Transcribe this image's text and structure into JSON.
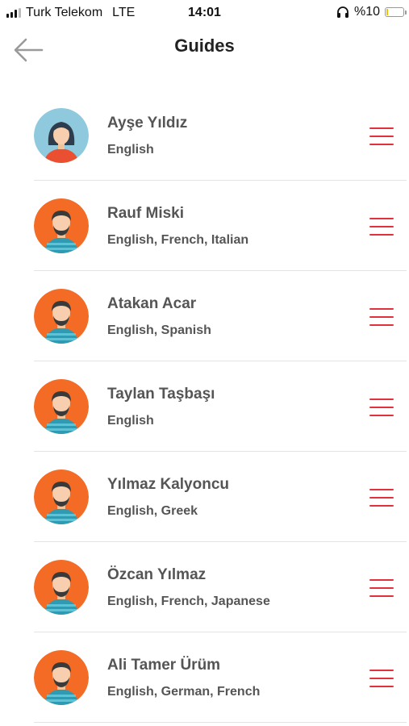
{
  "status_bar": {
    "carrier": "Turk Telekom",
    "network": "LTE",
    "time": "14:01",
    "battery": "%10",
    "battery_level": 0.1
  },
  "header": {
    "title": "Guides"
  },
  "colors": {
    "accent": "#e0323d",
    "male_avatar_bg": "#f36b24",
    "female_avatar_bg": "#8ec9dd"
  },
  "guides": [
    {
      "name": "Ayşe Yıldız",
      "languages": "English",
      "avatar": "female-avatar"
    },
    {
      "name": "Rauf Miski",
      "languages": "English, French, Italian",
      "avatar": "male-avatar"
    },
    {
      "name": "Atakan Acar",
      "languages": "English, Spanish",
      "avatar": "male-avatar"
    },
    {
      "name": "Taylan Taşbaşı",
      "languages": "English",
      "avatar": "male-avatar"
    },
    {
      "name": "Yılmaz Kalyoncu",
      "languages": "English, Greek",
      "avatar": "male-avatar"
    },
    {
      "name": "Özcan Yılmaz",
      "languages": "English, French, Japanese",
      "avatar": "male-avatar"
    },
    {
      "name": "Ali Tamer Ürüm",
      "languages": "English, German, French",
      "avatar": "male-avatar"
    }
  ]
}
